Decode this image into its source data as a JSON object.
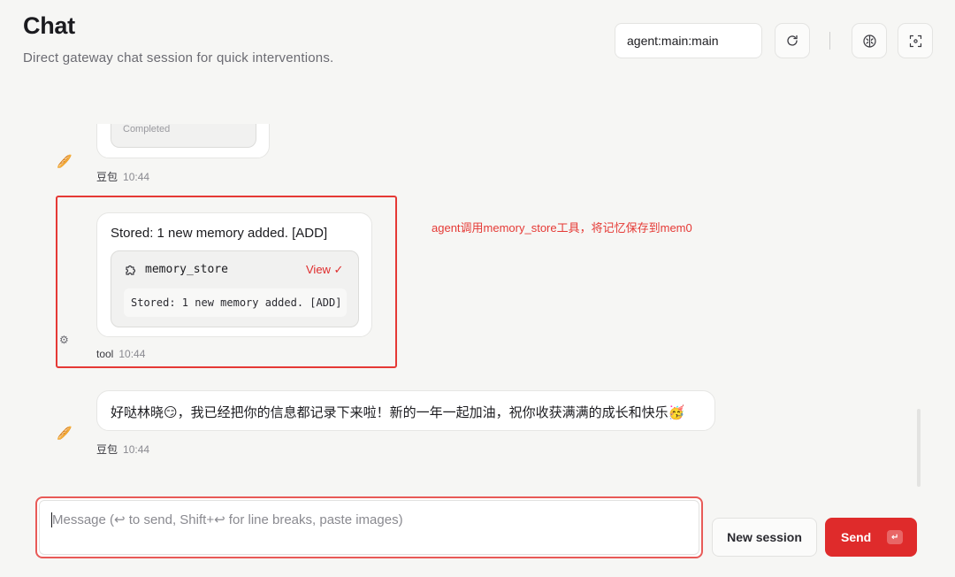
{
  "header": {
    "title": "Chat",
    "subtitle": "Direct gateway chat session for quick interventions.",
    "session_value": "agent:main:main"
  },
  "icons": {
    "refresh": "refresh-icon",
    "brain": "brain-icon",
    "focus": "focus-icon",
    "puzzle": "puzzle-icon",
    "check": "check-icon",
    "gear": "gear-icon",
    "assistant_avatar": "bread-avatar-icon"
  },
  "messages": [
    {
      "role": "assistant",
      "partial_card_text": "Completed",
      "sender": "豆包",
      "time": "10:44"
    },
    {
      "role": "tool",
      "text": "Stored: 1 new memory added. [ADD]",
      "tool_name": "memory_store",
      "view_label": "View ✓",
      "tool_output": "Stored: 1 new memory added. [ADD]",
      "sender": "tool",
      "time": "10:44"
    },
    {
      "role": "assistant",
      "text": "好哒林晓😏，我已经把你的信息都记录下来啦！新的一年一起加油，祝你收获满满的成长和快乐🥳",
      "sender": "豆包",
      "time": "10:44"
    }
  ],
  "annotation": "agent调用memory_store工具，将记忆保存到mem0",
  "composer": {
    "placeholder": "Message (↩ to send, Shift+↩ for line breaks, paste images)",
    "new_session_label": "New session",
    "send_label": "Send",
    "send_kbd": "↵"
  },
  "colors": {
    "accent_red": "#df2b2b",
    "annotation_red": "#e53935",
    "background": "#f6f6f4"
  }
}
